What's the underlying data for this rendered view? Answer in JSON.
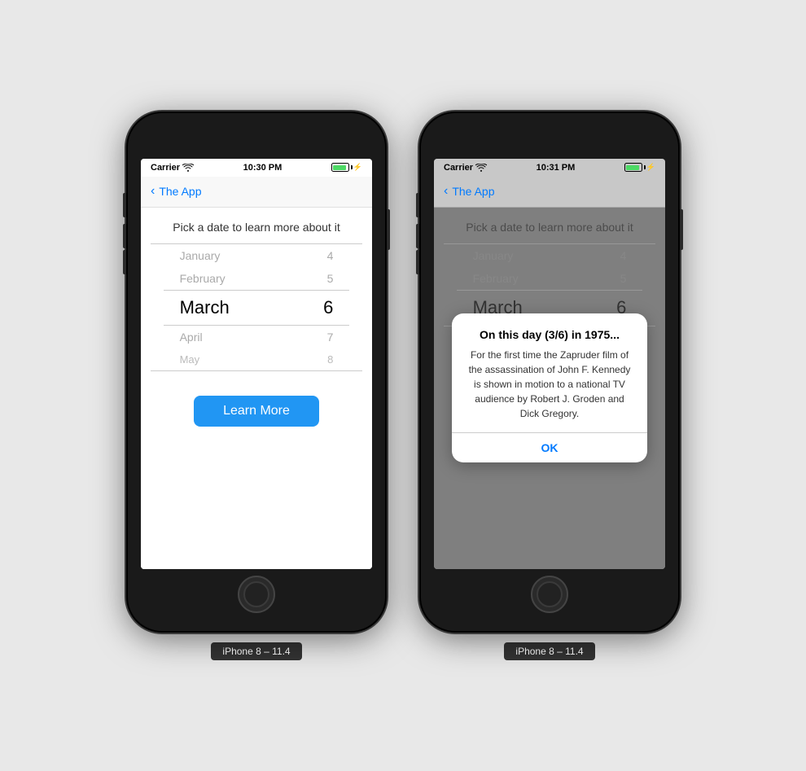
{
  "phone1": {
    "statusBar": {
      "carrier": "Carrier",
      "time": "10:30 PM"
    },
    "navBar": {
      "backLabel": "The App"
    },
    "main": {
      "title": "Pick a date to learn more about it",
      "pickerRows": [
        {
          "month": "January",
          "day": "4",
          "style": "faded"
        },
        {
          "month": "February",
          "day": "5",
          "style": "faded"
        },
        {
          "month": "March",
          "day": "6",
          "style": "selected"
        },
        {
          "month": "April",
          "day": "7",
          "style": "faded"
        },
        {
          "month": "May",
          "day": "8",
          "style": "faded2"
        }
      ],
      "buttonLabel": "Learn More"
    },
    "label": "iPhone 8 – 11.4"
  },
  "phone2": {
    "statusBar": {
      "carrier": "Carrier",
      "time": "10:31 PM"
    },
    "navBar": {
      "backLabel": "The App"
    },
    "main": {
      "title": "Pick a date to learn more about it",
      "pickerRows": [
        {
          "month": "January",
          "day": "4",
          "style": "faded"
        },
        {
          "month": "February",
          "day": "5",
          "style": "faded"
        },
        {
          "month": "March",
          "day": "6",
          "style": "selected"
        }
      ]
    },
    "alert": {
      "title": "On this day (3/6) in 1975...",
      "message": "For the first time the Zapruder film of the assassination of John F. Kennedy is shown in motion to a national TV audience by Robert J. Groden and Dick Gregory.",
      "okLabel": "OK"
    },
    "label": "iPhone 8 – 11.4"
  }
}
